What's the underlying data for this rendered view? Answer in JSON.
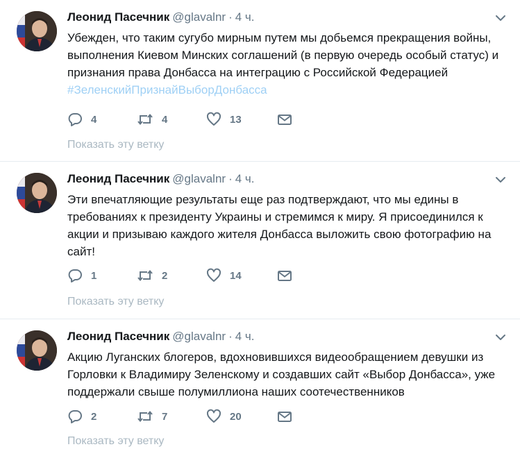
{
  "tweets": [
    {
      "author": "Леонид Пасечник",
      "handle": "@glavalnr",
      "dot": "·",
      "time": "4 ч.",
      "text": "Убежден, что таким сугубо мирным путем мы добьемся прекращения войны, выполнения Киевом Минских соглашений (в первую очередь особый статус) и признания права Донбасса на интеграцию с Российской Федерацией",
      "hashtag": "#ЗеленскийПризнайВыборДонбасса",
      "replies": "4",
      "retweets": "4",
      "likes": "13",
      "show_thread": "Показать эту ветку"
    },
    {
      "author": "Леонид Пасечник",
      "handle": "@glavalnr",
      "dot": "·",
      "time": "4 ч.",
      "text": "Эти впечатляющие результаты еще раз подтверждают, что мы едины в требованиях к президенту Украины и стремимся к миру. Я присоединился к акции и призываю каждого жителя Донбасса выложить свою фотографию на сайт!",
      "replies": "1",
      "retweets": "2",
      "likes": "14",
      "show_thread": "Показать эту ветку"
    },
    {
      "author": "Леонид Пасечник",
      "handle": "@glavalnr",
      "dot": "·",
      "time": "4 ч.",
      "text": "Акцию Луганских блогеров, вдохновившихся видеообращением девушки из Горловки к Владимиру Зеленскому и создавших сайт «Выбор Донбасса», уже поддержали свыше полумиллиона наших соотечественников",
      "replies": "2",
      "retweets": "7",
      "likes": "20",
      "show_thread": "Показать эту ветку"
    }
  ],
  "colors": {
    "text": "#14171a",
    "secondary": "#657786",
    "hashtag": "#9fd0f5",
    "muted": "#aab8c2",
    "divider": "#e6ecf0"
  },
  "icons": [
    "chevron-down-icon",
    "reply-icon",
    "retweet-icon",
    "like-icon",
    "direct-message-icon"
  ]
}
